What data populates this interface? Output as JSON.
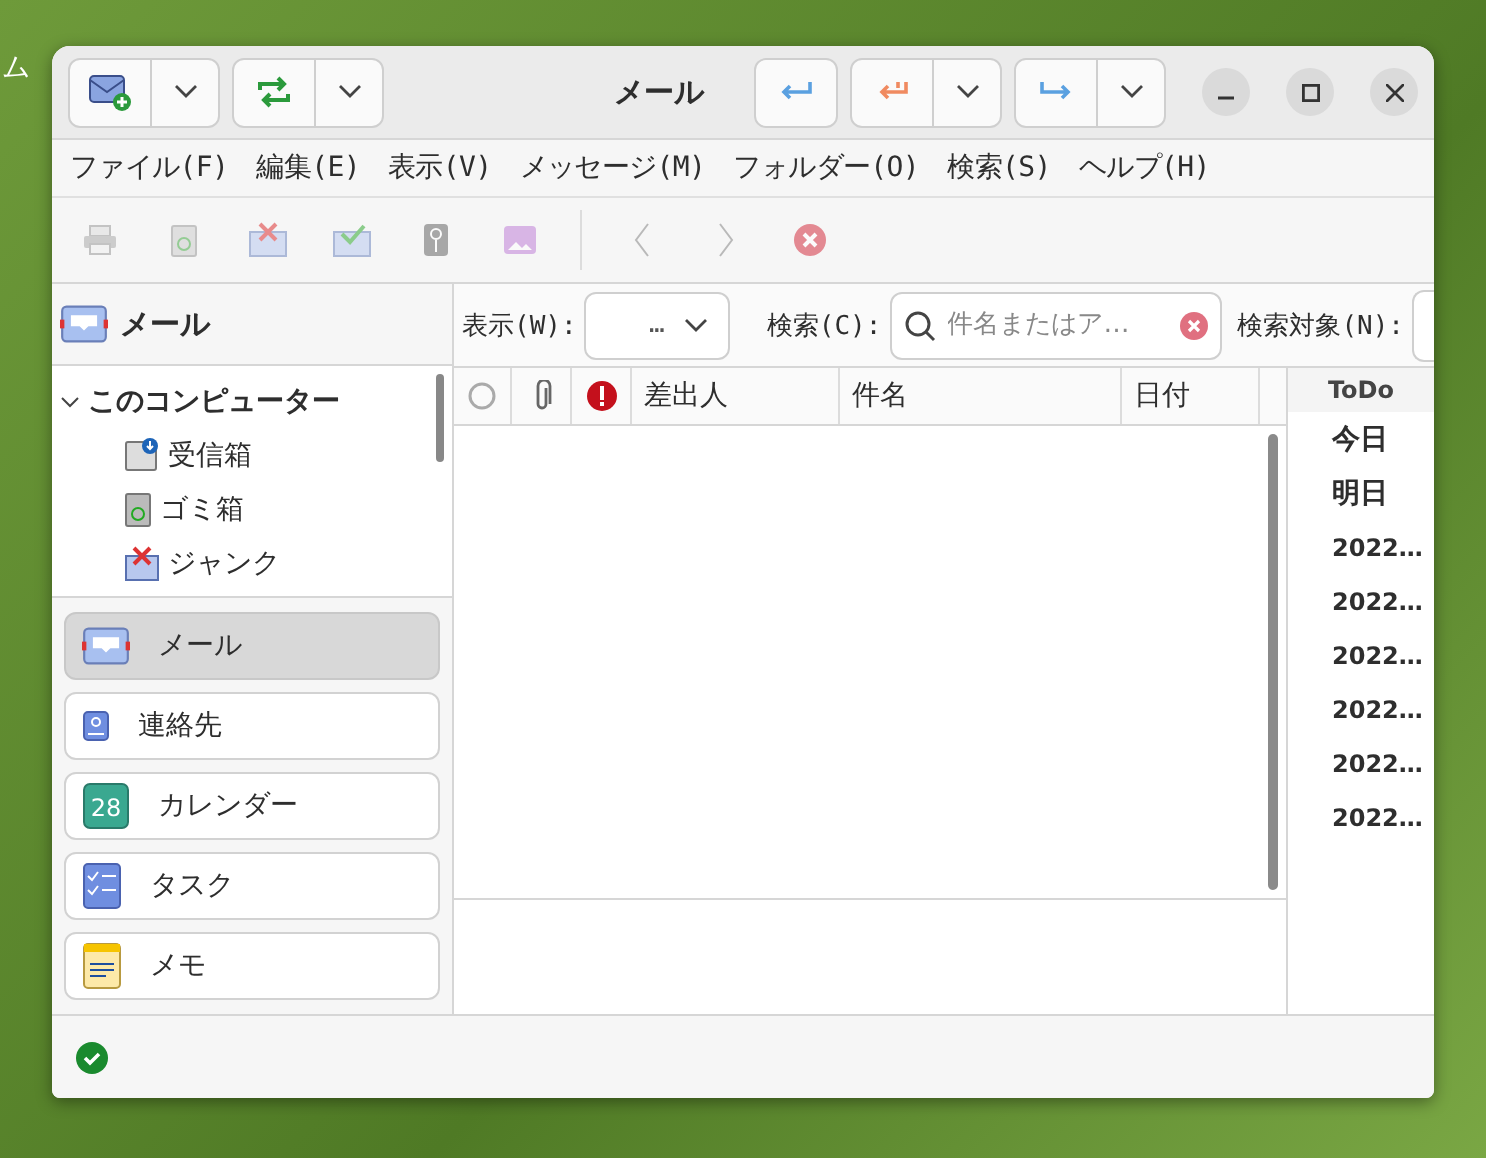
{
  "desktop": {
    "label": "ム"
  },
  "window": {
    "title": "メール"
  },
  "menu": [
    "ファイル(F)",
    "編集(E)",
    "表示(V)",
    "メッセージ(M)",
    "フォルダー(O)",
    "検索(S)",
    "ヘルプ(H)"
  ],
  "toolbar": {
    "buttons": [
      {
        "kind": "print",
        "disabled": true
      },
      {
        "kind": "trash",
        "disabled": true
      },
      {
        "kind": "junk",
        "disabled": true
      },
      {
        "kind": "notjunk",
        "disabled": true
      },
      {
        "kind": "archive",
        "disabled": true
      },
      {
        "kind": "image",
        "disabled": true
      },
      {
        "kind": "prev",
        "disabled": true
      },
      {
        "kind": "next",
        "disabled": true
      },
      {
        "kind": "stop",
        "disabled": true
      }
    ]
  },
  "sidebar": {
    "title": "メール",
    "tree": [
      {
        "label": "このコンピューター",
        "expanded": true,
        "children": [
          {
            "label": "受信箱",
            "kind": "inbox"
          },
          {
            "label": "ゴミ箱",
            "kind": "trash"
          },
          {
            "label": "ジャンク",
            "kind": "junk"
          }
        ]
      }
    ],
    "switcher": [
      {
        "label": "メール",
        "kind": "mail",
        "selected": true
      },
      {
        "label": "連絡先",
        "kind": "contacts",
        "selected": false
      },
      {
        "label": "カレンダー",
        "kind": "calendar",
        "icon_text": "28",
        "selected": false
      },
      {
        "label": "タスク",
        "kind": "tasks",
        "selected": false
      },
      {
        "label": "メモ",
        "kind": "memos",
        "selected": false
      }
    ]
  },
  "filter_bar": {
    "show_label": "表示(W):",
    "show_value": "…",
    "search_label": "検索(C):",
    "search_placeholder": "件名またはア…",
    "scope_label": "検索対象(N):"
  },
  "message_list": {
    "columns": [
      {
        "kind": "status"
      },
      {
        "kind": "attachment"
      },
      {
        "kind": "flag"
      },
      {
        "kind": "text",
        "label": "差出人"
      },
      {
        "kind": "text",
        "label": "件名"
      },
      {
        "kind": "text",
        "label": "日付"
      }
    ]
  },
  "todo": {
    "title": "ToDo",
    "items": [
      "今日",
      "明日",
      "2022…",
      "2022…",
      "2022…",
      "2022…",
      "2022…",
      "2022…"
    ]
  }
}
